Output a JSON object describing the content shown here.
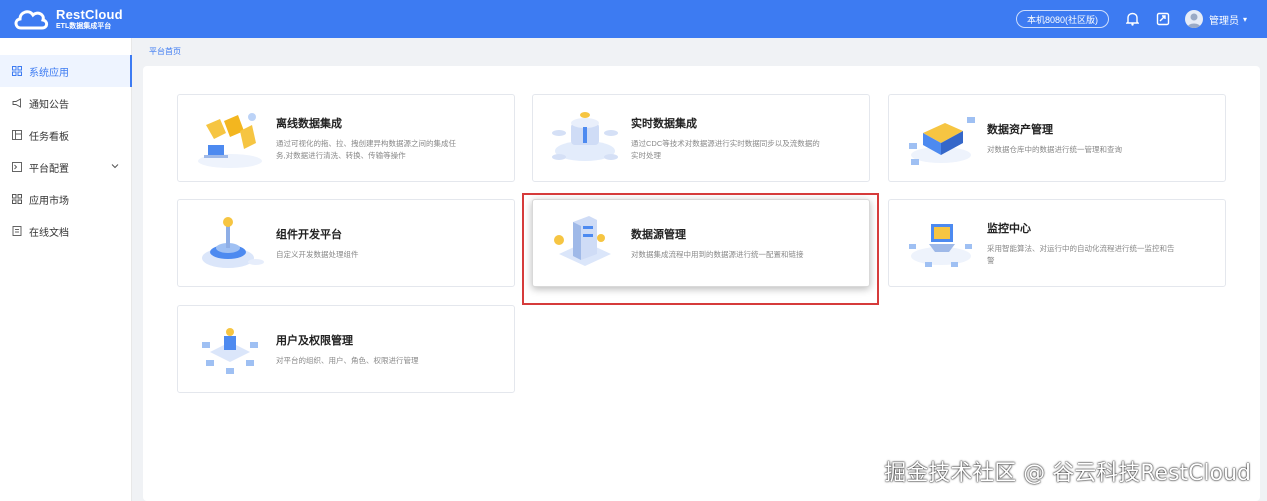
{
  "app": {
    "logo_title": "RestCloud",
    "logo_subtitle": "ETL数据集成平台",
    "brand_color": "#3d7bf2"
  },
  "header": {
    "env_badge": "本机8080(社区版)",
    "bell_icon": "bell-icon",
    "screen_icon": "share-screen-icon",
    "user_name": "管理员",
    "caret": "▾"
  },
  "sidebar": {
    "items": [
      {
        "label": "系统应用",
        "icon": "grid-icon",
        "active": true
      },
      {
        "label": "通知公告",
        "icon": "megaphone-icon",
        "active": false
      },
      {
        "label": "任务看板",
        "icon": "board-icon",
        "active": false
      },
      {
        "label": "平台配置",
        "icon": "terminal-icon",
        "active": false,
        "expandable": true
      },
      {
        "label": "应用市场",
        "icon": "grid-icon",
        "active": false
      },
      {
        "label": "在线文档",
        "icon": "document-icon",
        "active": false
      }
    ]
  },
  "breadcrumb": "平台首页",
  "cards": [
    {
      "title": "离线数据集成",
      "desc_1": "通过可视化的拖、拉、拽创建异构数据源之间的集成任",
      "desc_2": "务,对数据进行清洗、转换、传输等操作"
    },
    {
      "title": "实时数据集成",
      "desc_1": "通过CDC等技术对数据源进行实时数据同步以及流数据的",
      "desc_2": "实时处理"
    },
    {
      "title": "数据资产管理",
      "desc_1": "对数据仓库中的数据进行统一管理和查询",
      "desc_2": ""
    },
    {
      "title": "组件开发平台",
      "desc_1": "自定义开发数据处理组件",
      "desc_2": ""
    },
    {
      "title": "数据源管理",
      "desc_1": "对数据集成流程中用到的数据源进行统一配置和链接",
      "desc_2": ""
    },
    {
      "title": "监控中心",
      "desc_1": "采用智能算法、对运行中的自动化流程进行统一监控和告",
      "desc_2": "警"
    },
    {
      "title": "用户及权限管理",
      "desc_1": "对平台的组织、用户、角色、权限进行管理",
      "desc_2": ""
    }
  ],
  "watermark": "掘金技术社区 @ 谷云科技RestCloud"
}
